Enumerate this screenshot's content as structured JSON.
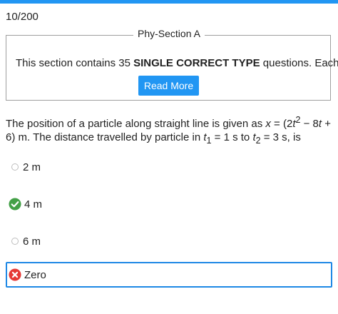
{
  "progress": "10/200",
  "section": {
    "title": "Phy-Section A",
    "desc_prefix": "This section contains 35 ",
    "desc_bold": "SINGLE CORRECT TYPE",
    "desc_suffix": " questions. Each",
    "read_more": "Read More"
  },
  "question": {
    "t1": "The position of a particle along straight line is given as ",
    "x": "x",
    "t2": " = (2",
    "t_var1": "t",
    "sup2": "2",
    "t3": " − 8",
    "t_var2": "t",
    "t4": " + 6) m. The distance travelled by particle in ",
    "t1_var": "t",
    "sub1": "1",
    "t5": " = 1 s to ",
    "t2_var": "t",
    "sub2": "2",
    "t6": " = 3 s, is"
  },
  "options": [
    {
      "label": "2 m",
      "state": "unselected"
    },
    {
      "label": "4 m",
      "state": "correct"
    },
    {
      "label": "6 m",
      "state": "unselected"
    },
    {
      "label": "Zero",
      "state": "wrong-selected"
    }
  ],
  "colors": {
    "accent": "#2196f3",
    "correct": "#43a047",
    "wrong": "#e53935"
  }
}
